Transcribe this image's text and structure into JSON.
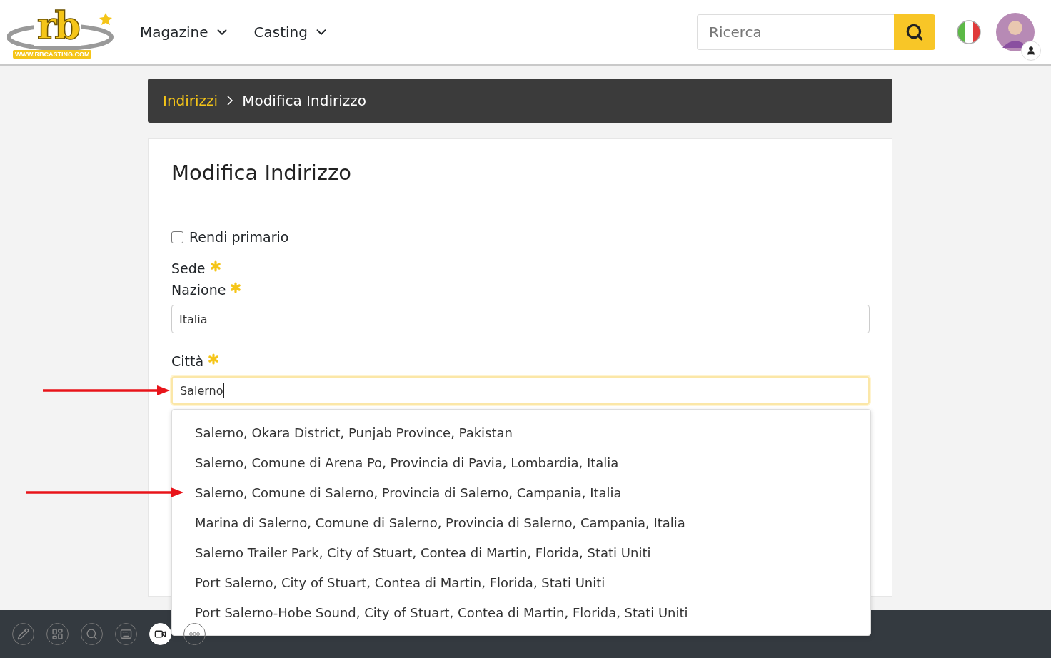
{
  "header": {
    "logo": {
      "mark": "rb",
      "url": "WWW.RBCASTING.COM"
    },
    "menu": [
      {
        "label": "Magazine"
      },
      {
        "label": "Casting"
      }
    ],
    "search": {
      "placeholder": "Ricerca"
    }
  },
  "breadcrumb": [
    {
      "label": "Indirizzi",
      "selected": false
    },
    {
      "label": "Modifica Indirizzo",
      "selected": true
    }
  ],
  "form": {
    "title": "Modifica Indirizzo",
    "primary": {
      "label": "Rendi primario",
      "checked": false
    },
    "fields": [
      {
        "kind": "label",
        "label": "Sede",
        "required": true
      },
      {
        "kind": "input",
        "label": "Nazione",
        "required": true,
        "value": "Italia",
        "focused": false
      },
      {
        "kind": "input",
        "label": "Città",
        "required": true,
        "value": "Salerno",
        "focused": true,
        "marked": true
      }
    ]
  },
  "suggestions": [
    {
      "text": "Salerno, Okara District, Punjab Province, Pakistan",
      "marked": false
    },
    {
      "text": "Salerno, Comune di Arena Po, Provincia di Pavia, Lombardia, Italia",
      "marked": false
    },
    {
      "text": "Salerno, Comune di Salerno, Provincia di Salerno, Campania, Italia",
      "marked": true
    },
    {
      "text": "Marina di Salerno, Comune di Salerno, Provincia di Salerno, Campania, Italia",
      "marked": false
    },
    {
      "text": "Salerno Trailer Park, City of Stuart, Contea di Martin, Florida, Stati Uniti",
      "marked": false
    },
    {
      "text": "Port Salerno, City of Stuart, Contea di Martin, Florida, Stati Uniti",
      "marked": false
    },
    {
      "text": "Port Salerno-Hobe Sound, City of Stuart, Contea di Martin, Florida, Stati Uniti",
      "marked": false
    }
  ],
  "toolbar": [
    {
      "kind": "pencil",
      "active": false
    },
    {
      "kind": "layout",
      "active": false
    },
    {
      "kind": "search",
      "active": false
    },
    {
      "kind": "keyboard",
      "active": false
    },
    {
      "kind": "video",
      "active": true
    },
    {
      "kind": "more",
      "active": false
    }
  ]
}
